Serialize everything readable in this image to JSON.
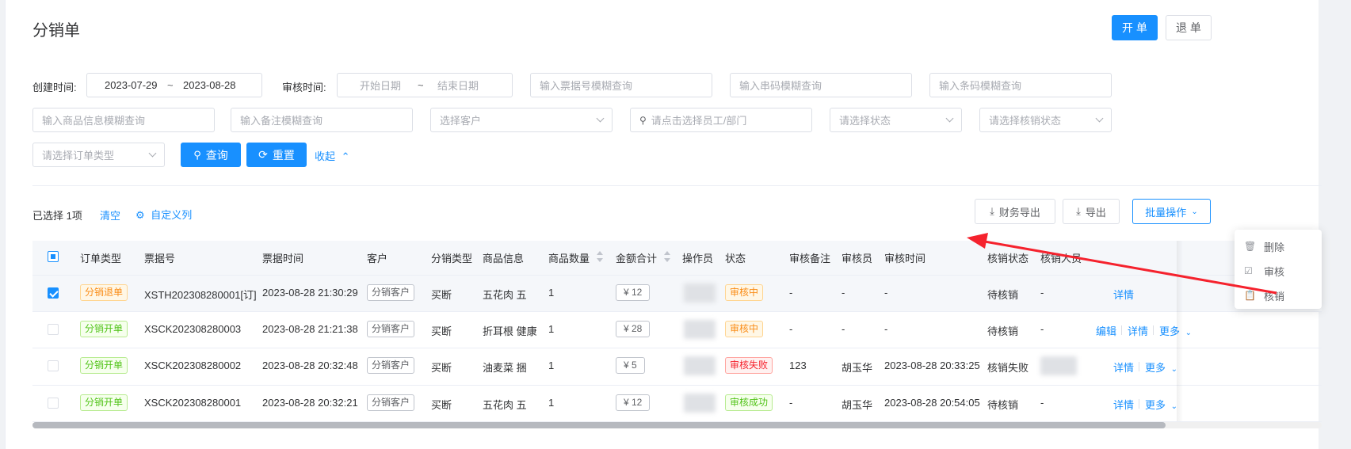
{
  "page": {
    "title": "分销单"
  },
  "header_buttons": {
    "open": "开 单",
    "return": "退 单"
  },
  "filters": {
    "create_time_label": "创建时间:",
    "create_start": "2023-07-29",
    "create_sep": "~",
    "create_end": "2023-08-28",
    "audit_time_label": "审核时间:",
    "audit_start_placeholder": "开始日期",
    "audit_sep": "~",
    "audit_end_placeholder": "结束日期",
    "ticket_placeholder": "输入票据号模糊查询",
    "serial_placeholder": "输入串码模糊查询",
    "barcode_placeholder": "输入条码模糊查询",
    "product_placeholder": "输入商品信息模糊查询",
    "remark_placeholder": "输入备注模糊查询",
    "customer_placeholder": "选择客户",
    "staff_placeholder": "请点击选择员工/部门",
    "status_placeholder": "请选择状态",
    "verify_status_placeholder": "请选择核销状态",
    "order_type_placeholder": "请选择订单类型",
    "query_button": "查询",
    "reset_button": "重置",
    "collapse_link": "收起"
  },
  "toolbar": {
    "selected_text": "已选择 1项",
    "clear_link": "清空",
    "custom_columns_link": "自定义列",
    "finance_export": "财务导出",
    "export": "导出",
    "batch_ops": "批量操作"
  },
  "dropdown": {
    "items": [
      {
        "icon": "trash-icon",
        "label": "删除"
      },
      {
        "icon": "checkbox-icon",
        "label": "审核"
      },
      {
        "icon": "clipboard-icon",
        "label": "核销"
      }
    ]
  },
  "table": {
    "headers": {
      "order_type": "订单类型",
      "ticket_no": "票据号",
      "ticket_time": "票据时间",
      "customer": "客户",
      "dist_type": "分销类型",
      "product": "商品信息",
      "qty": "商品数量",
      "amount": "金额合计",
      "operator": "操作员",
      "status": "状态",
      "audit_remark": "审核备注",
      "auditor": "审核员",
      "audit_time": "审核时间",
      "verify_status": "核销状态",
      "verifier": "核销人员"
    },
    "rows": [
      {
        "order_type": "分销退单",
        "ticket_no": "XSTH202308280001[订]",
        "ticket_time": "2023-08-28 21:30:29",
        "customer": "分销客户",
        "dist_type": "买断",
        "product": "五花肉 五",
        "qty": "1",
        "amount": "¥ 12",
        "status": "审核中",
        "audit_remark": "-",
        "auditor": "-",
        "audit_time": "-",
        "verify_status": "待核销",
        "verifier": "-",
        "detail": "详情"
      },
      {
        "order_type": "分销开单",
        "ticket_no": "XSCK202308280003",
        "ticket_time": "2023-08-28 21:21:38",
        "customer": "分销客户",
        "dist_type": "买断",
        "product": "折耳根 健康",
        "qty": "1",
        "amount": "¥ 28",
        "status": "审核中",
        "audit_remark": "-",
        "auditor": "-",
        "audit_time": "-",
        "verify_status": "待核销",
        "verifier": "-",
        "edit": "编辑",
        "detail": "详情",
        "more": "更多"
      },
      {
        "order_type": "分销开单",
        "ticket_no": "XSCK202308280002",
        "ticket_time": "2023-08-28 20:32:48",
        "customer": "分销客户",
        "dist_type": "买断",
        "product": "油麦菜 捆",
        "qty": "1",
        "amount": "¥ 5",
        "status": "审核失败",
        "audit_remark": "123",
        "auditor": "胡玉华",
        "audit_time": "2023-08-28 20:33:25",
        "verify_status": "核销失败",
        "verifier": "",
        "detail": "详情",
        "more": "更多"
      },
      {
        "order_type": "分销开单",
        "ticket_no": "XSCK202308280001",
        "ticket_time": "2023-08-28 20:32:21",
        "customer": "分销客户",
        "dist_type": "买断",
        "product": "五花肉 五",
        "qty": "1",
        "amount": "¥ 12",
        "status": "审核成功",
        "audit_remark": "-",
        "auditor": "胡玉华",
        "audit_time": "2023-08-28 20:54:05",
        "verify_status": "待核销",
        "verifier": "-",
        "detail": "详情",
        "more": "更多"
      }
    ]
  },
  "colors": {
    "primary": "#1890ff",
    "arrow": "#f5222d"
  }
}
